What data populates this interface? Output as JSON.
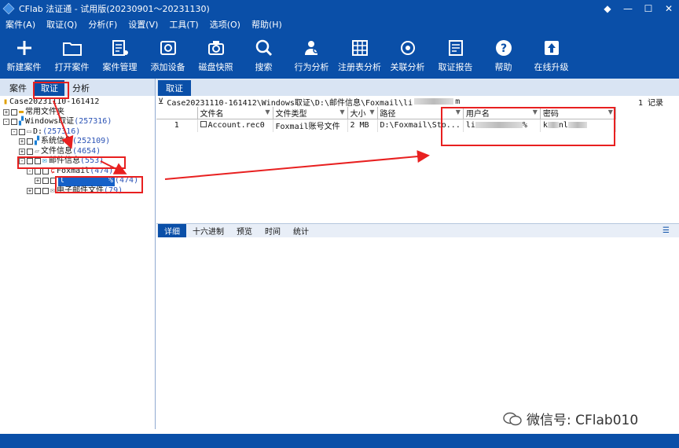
{
  "window": {
    "title": "CFlab 法证通 - 试用版(20230901～20231130)",
    "controls": [
      "◆",
      "—",
      "☐",
      "✕"
    ]
  },
  "menu": [
    "案件(A)",
    "取证(Q)",
    "分析(F)",
    "设置(V)",
    "工具(T)",
    "选项(O)",
    "帮助(H)"
  ],
  "toolbar": [
    {
      "label": "新建案件",
      "icon": "plus-icon"
    },
    {
      "label": "打开案件",
      "icon": "folder-icon"
    },
    {
      "label": "案件管理",
      "icon": "case-manage-icon"
    },
    {
      "label": "添加设备",
      "icon": "add-device-icon"
    },
    {
      "label": "磁盘快照",
      "icon": "camera-icon"
    },
    {
      "label": "搜索",
      "icon": "search-icon"
    },
    {
      "label": "行为分析",
      "icon": "user-search-icon"
    },
    {
      "label": "注册表分析",
      "icon": "registry-icon"
    },
    {
      "label": "关联分析",
      "icon": "relation-icon"
    },
    {
      "label": "取证报告",
      "icon": "report-icon"
    },
    {
      "label": "帮助",
      "icon": "help-icon"
    },
    {
      "label": "在线升级",
      "icon": "upload-icon"
    }
  ],
  "left_tabs": [
    "案件",
    "取证",
    "分析"
  ],
  "tree": {
    "case": "Case20231110-161412",
    "common_folder": "常用文件夹",
    "windows": "Windows取证",
    "windows_count": "(257316)",
    "drive": "D:",
    "drive_count": "(257316)",
    "sysinfo": "系统信息",
    "sysinfo_count": "(252109)",
    "fileinfo": "文件信息",
    "fileinfo_count": "(4654)",
    "mailinfo": "邮件信息",
    "mailinfo_count": "(553)",
    "foxmail": "Foxmail",
    "foxmail_count": "(474)",
    "account_prefix": "l",
    "account_suffix": "%",
    "account_count": "(474)",
    "email": "电子邮件文件",
    "email_count": "(79)"
  },
  "right_tab": "取证",
  "path": "Case20231110-161412\\Windows取证\\D:\\邮件信息\\Foxmail\\li",
  "path_tail": "m",
  "records": "1 记录",
  "table": {
    "headers": [
      "文件名",
      "文件类型",
      "大小",
      "路径",
      "用户名",
      "密码"
    ],
    "row": {
      "index": "1",
      "filename": "Account.rec0",
      "filetype": "Foxmail账号文件",
      "size": "2 MB",
      "path": "D:\\Foxmail\\Sto...",
      "user_prefix": "li",
      "user_suffix": "%",
      "pass_prefix": "k",
      "pass_suffix": "nl"
    }
  },
  "detail_tabs": [
    "详细",
    "十六进制",
    "预览",
    "时间",
    "统计"
  ],
  "watermark": "微信号: CFlab010",
  "colors": {
    "primary": "#0a4fa8",
    "annotation": "#e82020"
  }
}
